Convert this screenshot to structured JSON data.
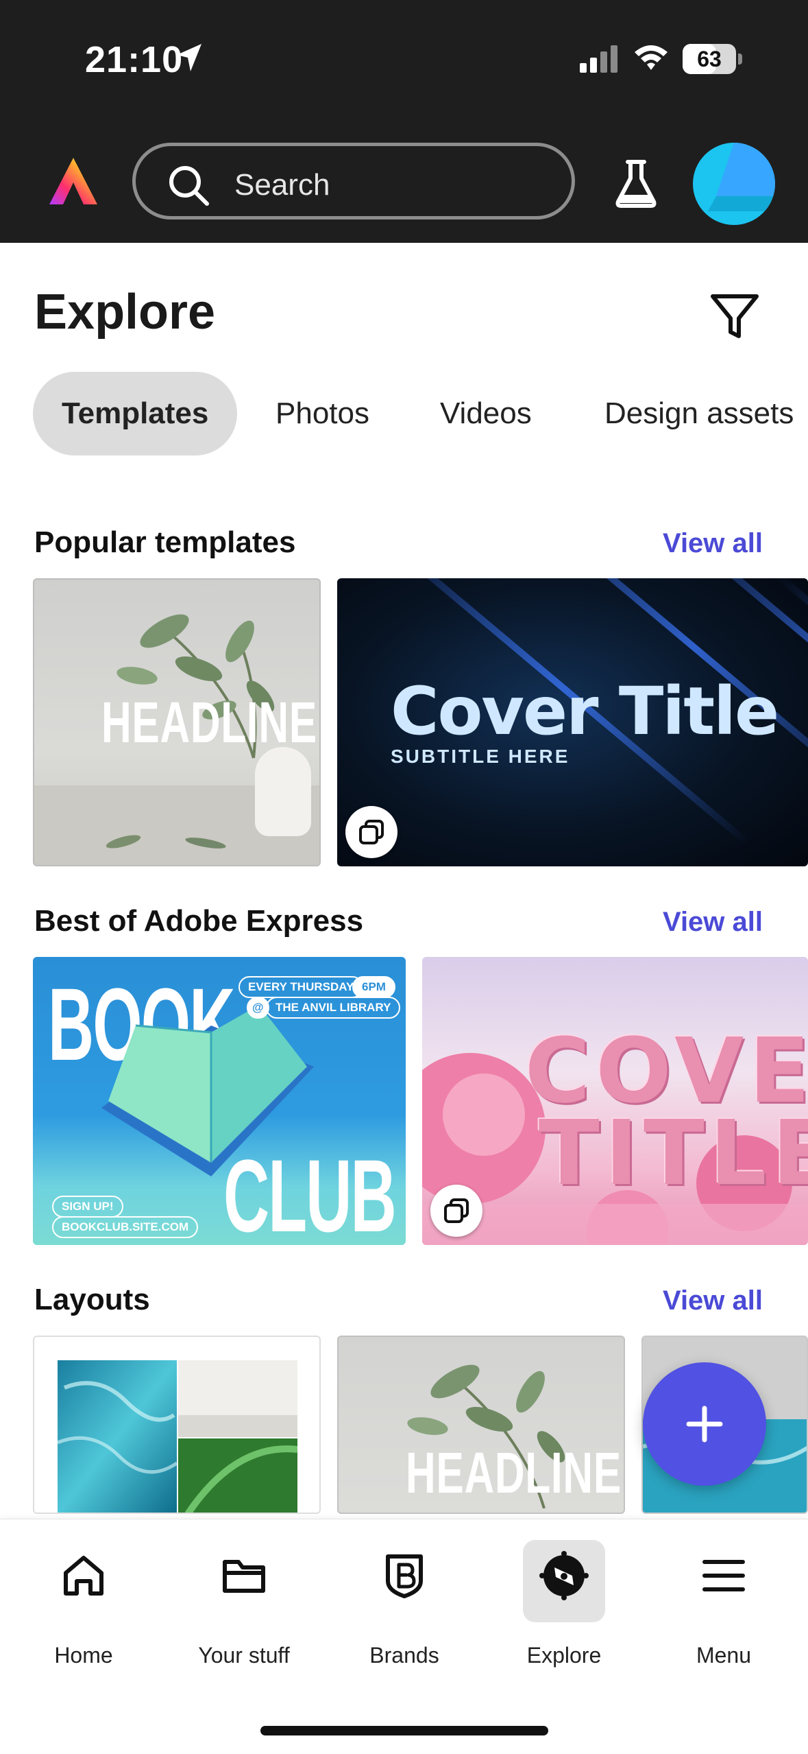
{
  "status_bar": {
    "time": "21:10",
    "battery": "63",
    "battery_level": 0.63
  },
  "header": {
    "search_placeholder": "Search"
  },
  "page": {
    "title": "Explore"
  },
  "tabs": [
    {
      "label": "Templates",
      "active": true
    },
    {
      "label": "Photos",
      "active": false
    },
    {
      "label": "Videos",
      "active": false
    },
    {
      "label": "Design assets",
      "active": false
    }
  ],
  "sections": {
    "popular": {
      "title": "Popular templates",
      "view_all": "View all",
      "cards": [
        {
          "text": "HEADLINE"
        },
        {
          "title": "Cover Title",
          "subtitle": "SUBTITLE HERE"
        }
      ]
    },
    "best": {
      "title": "Best of Adobe Express",
      "view_all": "View all",
      "cards": [
        {
          "line1": "BOOK",
          "line2": "CLUB",
          "pill_day": "EVERY THURSDAY",
          "pill_time": "6PM",
          "pill_at": "@",
          "pill_place": "THE ANVIL LIBRARY",
          "signup": "SIGN UP!",
          "site": "BOOKCLUB.SITE.COM"
        },
        {
          "line1": "COVER",
          "line2": "TITLE"
        }
      ]
    },
    "layouts": {
      "title": "Layouts",
      "view_all": "View all",
      "cards": [
        {
          "text": ""
        },
        {
          "text": "HEADLINE"
        }
      ]
    }
  },
  "bottom_nav": [
    {
      "label": "Home",
      "icon": "home-icon",
      "active": false
    },
    {
      "label": "Your stuff",
      "icon": "folder-icon",
      "active": false
    },
    {
      "label": "Brands",
      "icon": "brands-icon",
      "active": false
    },
    {
      "label": "Explore",
      "icon": "compass-icon",
      "active": true
    },
    {
      "label": "Menu",
      "icon": "hamburger-icon",
      "active": false
    }
  ],
  "colors": {
    "accent": "#4b4ad6",
    "fab": "#5151e3",
    "header_bg": "#1e1e1e",
    "avatar": "#1cc4f0"
  }
}
